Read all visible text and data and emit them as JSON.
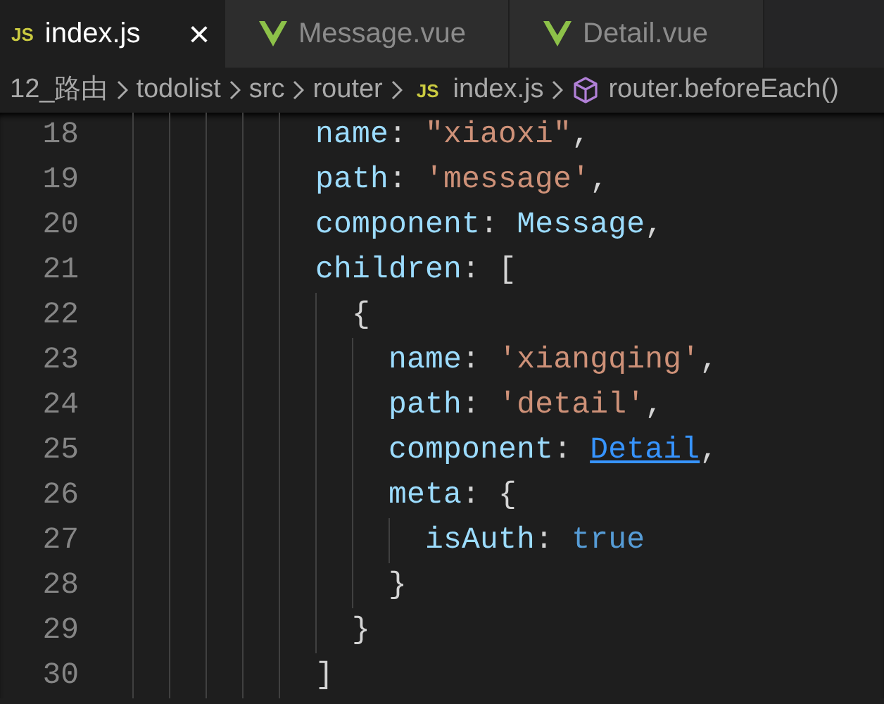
{
  "tabs": [
    {
      "label": "index.js",
      "selected": true,
      "kind": "js",
      "badge": "JS",
      "close": "×"
    },
    {
      "label": "Message.vue",
      "selected": false,
      "kind": "vue"
    },
    {
      "label": "Detail.vue",
      "selected": false,
      "kind": "vue"
    }
  ],
  "breadcrumb": [
    {
      "label": "12_路由",
      "kind": "folder"
    },
    {
      "label": "todolist",
      "kind": "folder"
    },
    {
      "label": "src",
      "kind": "folder"
    },
    {
      "label": "router",
      "kind": "folder"
    },
    {
      "label": "index.js",
      "kind": "js",
      "badge": "JS"
    },
    {
      "label": "router.beforeEach()",
      "kind": "method"
    }
  ],
  "code_lines": [
    {
      "number": "18",
      "tokens": [
        {
          "text": "          name",
          "kind": "property"
        },
        {
          "text": ": ",
          "kind": "punct"
        },
        {
          "text": "\"xiaoxi\"",
          "kind": "string"
        },
        {
          "text": ",",
          "kind": "punct"
        }
      ]
    },
    {
      "number": "19",
      "tokens": [
        {
          "text": "          path",
          "kind": "property"
        },
        {
          "text": ": ",
          "kind": "punct"
        },
        {
          "text": "'message'",
          "kind": "string"
        },
        {
          "text": ",",
          "kind": "punct"
        }
      ]
    },
    {
      "number": "20",
      "tokens": [
        {
          "text": "          component",
          "kind": "property"
        },
        {
          "text": ": ",
          "kind": "punct"
        },
        {
          "text": "Message",
          "kind": "variable"
        },
        {
          "text": ",",
          "kind": "punct"
        }
      ]
    },
    {
      "number": "21",
      "tokens": [
        {
          "text": "          children",
          "kind": "property"
        },
        {
          "text": ": [",
          "kind": "punct"
        }
      ]
    },
    {
      "number": "22",
      "tokens": [
        {
          "text": "            {",
          "kind": "punct"
        }
      ]
    },
    {
      "number": "23",
      "tokens": [
        {
          "text": "              name",
          "kind": "property"
        },
        {
          "text": ": ",
          "kind": "punct"
        },
        {
          "text": "'xiangqing'",
          "kind": "string"
        },
        {
          "text": ",",
          "kind": "punct"
        }
      ]
    },
    {
      "number": "24",
      "tokens": [
        {
          "text": "              path",
          "kind": "property"
        },
        {
          "text": ": ",
          "kind": "punct"
        },
        {
          "text": "'detail'",
          "kind": "string"
        },
        {
          "text": ",",
          "kind": "punct"
        }
      ]
    },
    {
      "number": "25",
      "tokens": [
        {
          "text": "              component",
          "kind": "property"
        },
        {
          "text": ": ",
          "kind": "punct"
        },
        {
          "text": "Detail",
          "kind": "link"
        },
        {
          "text": ",",
          "kind": "punct"
        }
      ]
    },
    {
      "number": "26",
      "tokens": [
        {
          "text": "              meta",
          "kind": "property"
        },
        {
          "text": ": {",
          "kind": "punct"
        }
      ]
    },
    {
      "number": "27",
      "tokens": [
        {
          "text": "                isAuth",
          "kind": "property"
        },
        {
          "text": ": ",
          "kind": "punct"
        },
        {
          "text": "true",
          "kind": "keyword"
        }
      ]
    },
    {
      "number": "28",
      "tokens": [
        {
          "text": "              }",
          "kind": "punct"
        }
      ]
    },
    {
      "number": "29",
      "tokens": [
        {
          "text": "            }",
          "kind": "punct"
        }
      ]
    },
    {
      "number": "30",
      "tokens": [
        {
          "text": "          ]",
          "kind": "punct"
        }
      ]
    }
  ]
}
